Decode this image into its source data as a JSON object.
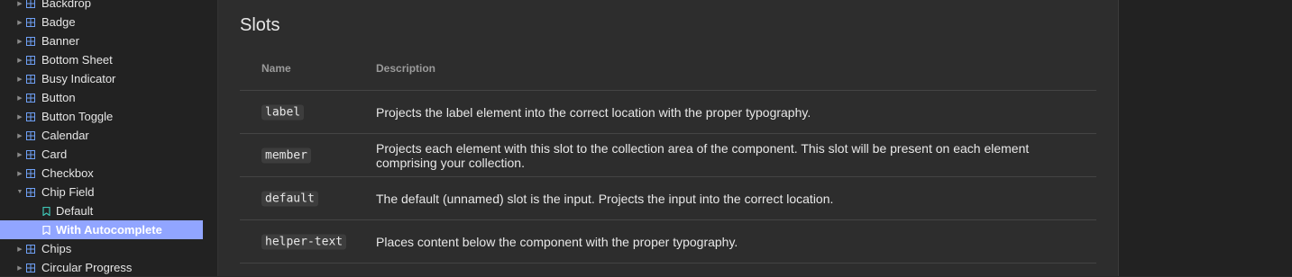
{
  "sidebar": {
    "items": [
      {
        "label": "Backdrop",
        "type": "component",
        "expanded": false
      },
      {
        "label": "Badge",
        "type": "component",
        "expanded": false
      },
      {
        "label": "Banner",
        "type": "component",
        "expanded": false
      },
      {
        "label": "Bottom Sheet",
        "type": "component",
        "expanded": false
      },
      {
        "label": "Busy Indicator",
        "type": "component",
        "expanded": false
      },
      {
        "label": "Button",
        "type": "component",
        "expanded": false
      },
      {
        "label": "Button Toggle",
        "type": "component",
        "expanded": false
      },
      {
        "label": "Calendar",
        "type": "component",
        "expanded": false
      },
      {
        "label": "Card",
        "type": "component",
        "expanded": false
      },
      {
        "label": "Checkbox",
        "type": "component",
        "expanded": false
      },
      {
        "label": "Chip Field",
        "type": "component",
        "expanded": true
      },
      {
        "label": "Default",
        "type": "story",
        "selected": false
      },
      {
        "label": "With Autocomplete",
        "type": "story",
        "selected": true
      },
      {
        "label": "Chips",
        "type": "component",
        "expanded": false
      },
      {
        "label": "Circular Progress",
        "type": "component",
        "expanded": false
      }
    ],
    "icons": {
      "component": "component-grid-icon",
      "story": "bookmark-icon",
      "caret_collapsed": "caret-right-icon",
      "caret_expanded": "caret-down-icon"
    },
    "colors": {
      "component_icon": "#6fa0f5",
      "story_icon": "#3fc5b5",
      "selected_bg": "#91a5ff"
    }
  },
  "main": {
    "title": "Slots",
    "table": {
      "headers": {
        "name": "Name",
        "description": "Description"
      },
      "rows": [
        {
          "name": "label",
          "description": "Projects the label element into the correct location with the proper typography."
        },
        {
          "name": "member",
          "description": "Projects each element with this slot to the collection area of the component. This slot will be present on each element comprising your collection."
        },
        {
          "name": "default",
          "description": "The default (unnamed) slot is the input. Projects the input into the correct location."
        },
        {
          "name": "helper-text",
          "description": "Places content below the component with the proper typography."
        }
      ]
    }
  }
}
